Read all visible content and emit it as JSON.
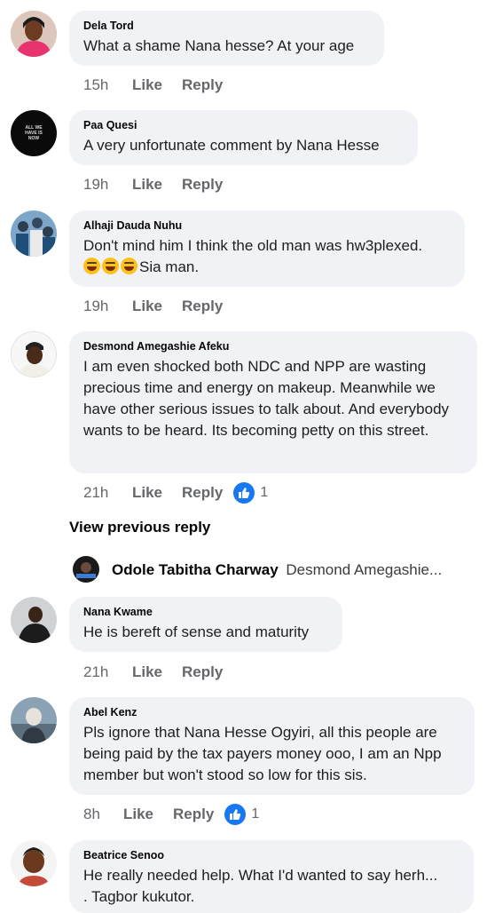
{
  "comments": [
    {
      "name": "Dela Tord",
      "text": "What a shame Nana hesse? At your age",
      "time": "15h",
      "like": "Like",
      "reply": "Reply"
    },
    {
      "name": "Paa Quesi",
      "text": "A very unfortunate comment by Nana Hesse",
      "time": "19h",
      "like": "Like",
      "reply": "Reply"
    },
    {
      "name": "Alhaji Dauda Nuhu",
      "text": "Don't mind him I think the old man was hw3plexed.",
      "text2": "Sia man.",
      "time": "19h",
      "like": "Like",
      "reply": "Reply"
    },
    {
      "name": "Desmond Amegashie Afeku",
      "text": "I am even shocked both NDC and NPP are wasting precious time and energy on makeup. Meanwhile we have other serious issues to talk about. And everybody wants to be heard. Its becoming petty on this street.",
      "time": "21h",
      "like": "Like",
      "reply": "Reply",
      "reactions": "1"
    },
    {
      "name": "Nana Kwame",
      "text": "He is bereft of sense and maturity",
      "time": "21h",
      "like": "Like",
      "reply": "Reply"
    },
    {
      "name": "Abel Kenz",
      "text": "Pls ignore that Nana Hesse Ogyiri, all this people are being paid by the tax payers money ooo, I am an Npp member but won't stood so low for this sis.",
      "time": "8h",
      "like": "Like",
      "reply": "Reply",
      "reactions": "1"
    },
    {
      "name": "Beatrice Senoo",
      "text": "He really needed help. What I'd wanted to say herh...",
      "text2": ". Tagbor kukutor."
    }
  ],
  "view_previous": "View previous reply",
  "reply_preview": {
    "name": "Odole Tabitha Charway",
    "text": "Desmond Amegashie..."
  },
  "avatar_text": {
    "paa_quesi": "ALL WE HAVE IS NOW"
  },
  "colors": {
    "bubble": "#f0f2f5",
    "meta": "#65676b",
    "link_blue": "#1877f2"
  }
}
